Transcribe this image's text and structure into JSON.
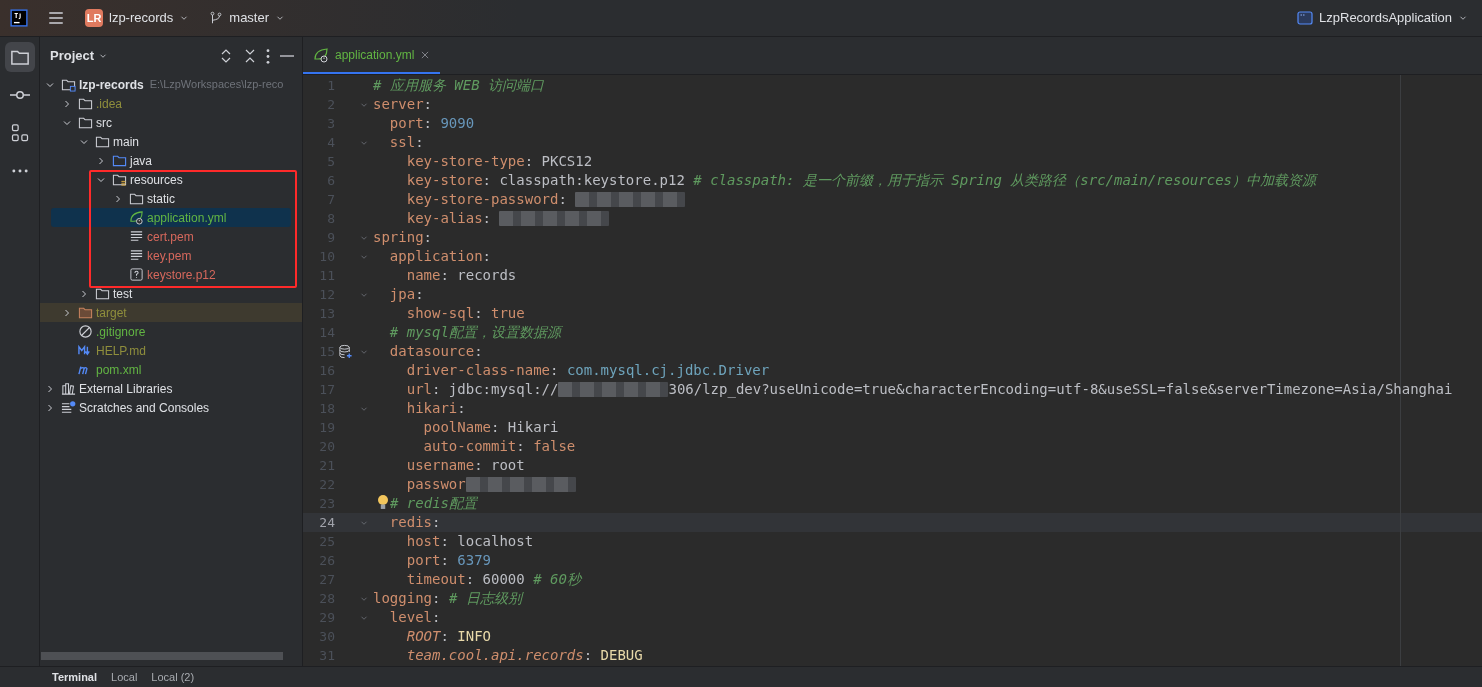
{
  "toolbar": {
    "project_badge": "LR",
    "project": "lzp-records",
    "branch": "master",
    "run_config": "LzpRecordsApplication"
  },
  "side_tools": [
    {
      "kind": "project",
      "selected": true
    },
    {
      "kind": "commit",
      "selected": false
    },
    {
      "kind": "structure",
      "selected": false
    },
    {
      "kind": "more",
      "selected": false
    }
  ],
  "project_panel": {
    "title": "Project",
    "tree": [
      {
        "label": "lzp-records",
        "hint": "E:\\LzpWorkspaces\\lzp-reco",
        "kind": "module",
        "color": "#dfe1e5",
        "bold": true,
        "expanded": true,
        "selected": false,
        "children": [
          {
            "label": ".idea",
            "kind": "folder",
            "color": "#8f8e3c",
            "expanded": false,
            "selected": false
          },
          {
            "label": "src",
            "kind": "folder",
            "color": "#dfe1e5",
            "expanded": true,
            "selected": false,
            "children": [
              {
                "label": "main",
                "kind": "folder",
                "color": "#dfe1e5",
                "expanded": true,
                "selected": false,
                "children": [
                  {
                    "label": "java",
                    "kind": "source_folder",
                    "color": "#dfe1e5",
                    "expanded": false,
                    "selected": false
                  },
                  {
                    "label": "resources",
                    "kind": "resource_folder",
                    "color": "#dfe1e5",
                    "expanded": true,
                    "selected": false,
                    "children": [
                      {
                        "label": "static",
                        "kind": "folder",
                        "color": "#dfe1e5",
                        "expanded": false,
                        "selected": false
                      },
                      {
                        "label": "application.yml",
                        "kind": "spring_yaml",
                        "color": "#62b543",
                        "selected": true
                      },
                      {
                        "label": "cert.pem",
                        "kind": "text",
                        "color": "#d7685c",
                        "selected": false
                      },
                      {
                        "label": "key.pem",
                        "kind": "text",
                        "color": "#d7685c",
                        "selected": false
                      },
                      {
                        "label": "keystore.p12",
                        "kind": "unknown",
                        "color": "#d7685c",
                        "selected": false
                      }
                    ]
                  }
                ]
              },
              {
                "label": "test",
                "kind": "folder",
                "color": "#dfe1e5",
                "expanded": false,
                "selected": false
              }
            ]
          },
          {
            "label": "target",
            "kind": "excluded_folder",
            "color": "#8f8e3c",
            "expanded": false,
            "selected": false
          },
          {
            "label": ".gitignore",
            "kind": "ignore",
            "color": "#62b543",
            "selected": false
          },
          {
            "label": "HELP.md",
            "kind": "markdown",
            "color": "#8f8e3c",
            "selected": false
          },
          {
            "label": "pom.xml",
            "kind": "maven",
            "color": "#62b543",
            "selected": false
          }
        ]
      },
      {
        "label": "External Libraries",
        "kind": "libraries",
        "color": "#dfe1e5",
        "expanded": false,
        "selected": false
      },
      {
        "label": "Scratches and Consoles",
        "kind": "scratches",
        "color": "#dfe1e5",
        "expanded": false,
        "selected": false
      }
    ]
  },
  "editor_tabs": [
    {
      "label": "application.yml",
      "selected": true
    }
  ],
  "code_lines": [
    {
      "number": "1",
      "foldable": false,
      "current": false,
      "tokens": [
        {
          "kind": "comment",
          "text": "# 应用服务 WEB 访问端口"
        }
      ]
    },
    {
      "number": "2",
      "foldable": true,
      "current": false,
      "tokens": [
        {
          "kind": "key",
          "text": "server"
        },
        {
          "kind": "plain",
          "text": ":"
        }
      ]
    },
    {
      "number": "3",
      "foldable": false,
      "current": false,
      "tokens": [
        {
          "kind": "key",
          "text": "  port"
        },
        {
          "kind": "plain",
          "text": ": "
        },
        {
          "kind": "number",
          "text": "9090"
        }
      ]
    },
    {
      "number": "4",
      "foldable": true,
      "current": false,
      "tokens": [
        {
          "kind": "key",
          "text": "  ssl"
        },
        {
          "kind": "plain",
          "text": ":"
        }
      ]
    },
    {
      "number": "5",
      "foldable": false,
      "current": false,
      "tokens": [
        {
          "kind": "key",
          "text": "    key-store-type"
        },
        {
          "kind": "plain",
          "text": ": PKCS12"
        }
      ]
    },
    {
      "number": "6",
      "foldable": false,
      "current": false,
      "tokens": [
        {
          "kind": "key",
          "text": "    key-store"
        },
        {
          "kind": "plain",
          "text": ": classpath:keystore.p12 "
        },
        {
          "kind": "comment",
          "text": "# classpath: 是一个前缀，用于指示 Spring 从类路径（src/main/resources）中加载资源"
        }
      ]
    },
    {
      "number": "7",
      "foldable": false,
      "current": false,
      "tokens": [
        {
          "kind": "key",
          "text": "    key-store-password"
        },
        {
          "kind": "plain",
          "text": ": "
        },
        {
          "kind": "redacted"
        }
      ]
    },
    {
      "number": "8",
      "foldable": false,
      "current": false,
      "tokens": [
        {
          "kind": "key",
          "text": "    key-alias"
        },
        {
          "kind": "plain",
          "text": ": "
        },
        {
          "kind": "redacted"
        }
      ]
    },
    {
      "number": "9",
      "foldable": true,
      "current": false,
      "tokens": [
        {
          "kind": "key",
          "text": "spring"
        },
        {
          "kind": "plain",
          "text": ":"
        }
      ]
    },
    {
      "number": "10",
      "foldable": true,
      "current": false,
      "tokens": [
        {
          "kind": "key",
          "text": "  application"
        },
        {
          "kind": "plain",
          "text": ":"
        }
      ]
    },
    {
      "number": "11",
      "foldable": false,
      "current": false,
      "tokens": [
        {
          "kind": "key",
          "text": "    name"
        },
        {
          "kind": "plain",
          "text": ": records"
        }
      ]
    },
    {
      "number": "12",
      "foldable": true,
      "current": false,
      "tokens": [
        {
          "kind": "key",
          "text": "  jpa"
        },
        {
          "kind": "plain",
          "text": ":"
        }
      ]
    },
    {
      "number": "13",
      "foldable": false,
      "current": false,
      "tokens": [
        {
          "kind": "key",
          "text": "    show-sql"
        },
        {
          "kind": "plain",
          "text": ": "
        },
        {
          "kind": "bool",
          "text": "true"
        }
      ]
    },
    {
      "number": "14",
      "foldable": false,
      "current": false,
      "tokens": [
        {
          "kind": "comment",
          "text": "  # mysql配置，设置数据源"
        }
      ]
    },
    {
      "number": "15",
      "foldable": true,
      "current": false,
      "database_marker": true,
      "tokens": [
        {
          "kind": "key",
          "text": "  datasource"
        },
        {
          "kind": "plain",
          "text": ":"
        }
      ]
    },
    {
      "number": "16",
      "foldable": false,
      "current": false,
      "tokens": [
        {
          "kind": "key",
          "text": "    driver-class-name"
        },
        {
          "kind": "plain",
          "text": ": "
        },
        {
          "kind": "class",
          "text": "com.mysql.cj.jdbc.Driver"
        }
      ]
    },
    {
      "number": "17",
      "foldable": false,
      "current": false,
      "tokens": [
        {
          "kind": "key",
          "text": "    url"
        },
        {
          "kind": "plain",
          "text": ": jdbc:mysql://"
        },
        {
          "kind": "redacted"
        },
        {
          "kind": "plain",
          "text": "306/lzp_dev?useUnicode=true&characterEncoding=utf-8&useSSL=false&serverTimezone=Asia/Shanghai"
        }
      ]
    },
    {
      "number": "18",
      "foldable": true,
      "current": false,
      "tokens": [
        {
          "kind": "key",
          "text": "    hikari"
        },
        {
          "kind": "plain",
          "text": ":"
        }
      ]
    },
    {
      "number": "19",
      "foldable": false,
      "current": false,
      "tokens": [
        {
          "kind": "key",
          "text": "      poolName"
        },
        {
          "kind": "plain",
          "text": ": Hikari"
        }
      ]
    },
    {
      "number": "20",
      "foldable": false,
      "current": false,
      "tokens": [
        {
          "kind": "key",
          "text": "      auto-commit"
        },
        {
          "kind": "plain",
          "text": ": "
        },
        {
          "kind": "bool",
          "text": "false"
        }
      ]
    },
    {
      "number": "21",
      "foldable": false,
      "current": false,
      "tokens": [
        {
          "kind": "key",
          "text": "    username"
        },
        {
          "kind": "plain",
          "text": ": root"
        }
      ]
    },
    {
      "number": "22",
      "foldable": false,
      "current": false,
      "tokens": [
        {
          "kind": "key",
          "text": "    passwor"
        },
        {
          "kind": "redacted"
        }
      ]
    },
    {
      "number": "23",
      "foldable": false,
      "current": false,
      "bulb": true,
      "tokens": [
        {
          "kind": "comment",
          "text": "# redis配置"
        }
      ]
    },
    {
      "number": "24",
      "foldable": true,
      "current": true,
      "tokens": [
        {
          "kind": "key",
          "text": "  redis"
        },
        {
          "kind": "plain",
          "text": ":"
        }
      ]
    },
    {
      "number": "25",
      "foldable": false,
      "current": false,
      "tokens": [
        {
          "kind": "key",
          "text": "    host"
        },
        {
          "kind": "plain",
          "text": ": localhost"
        }
      ]
    },
    {
      "number": "26",
      "foldable": false,
      "current": false,
      "tokens": [
        {
          "kind": "key",
          "text": "    port"
        },
        {
          "kind": "plain",
          "text": ": "
        },
        {
          "kind": "number",
          "text": "6379"
        }
      ]
    },
    {
      "number": "27",
      "foldable": false,
      "current": false,
      "tokens": [
        {
          "kind": "key",
          "text": "    timeout"
        },
        {
          "kind": "plain",
          "text": ": 60000 "
        },
        {
          "kind": "comment",
          "text": "# 60秒"
        }
      ]
    },
    {
      "number": "28",
      "foldable": true,
      "current": false,
      "tokens": [
        {
          "kind": "key",
          "text": "logging"
        },
        {
          "kind": "plain",
          "text": ": "
        },
        {
          "kind": "comment",
          "text": "# 日志级别"
        }
      ]
    },
    {
      "number": "29",
      "foldable": true,
      "current": false,
      "tokens": [
        {
          "kind": "key",
          "text": "  level"
        },
        {
          "kind": "plain",
          "text": ":"
        }
      ]
    },
    {
      "number": "30",
      "foldable": false,
      "current": false,
      "tokens": [
        {
          "kind": "key_italic",
          "text": "    ROOT"
        },
        {
          "kind": "plain",
          "text": ": "
        },
        {
          "kind": "enum",
          "text": "INFO"
        }
      ]
    },
    {
      "number": "31",
      "foldable": false,
      "current": false,
      "tokens": [
        {
          "kind": "key_italic",
          "text": "    team.cool.api.records"
        },
        {
          "kind": "plain",
          "text": ": "
        },
        {
          "kind": "enum",
          "text": "DEBUG"
        }
      ]
    }
  ],
  "bottom_tabs": [
    {
      "label": "Terminal",
      "selected": true
    },
    {
      "label": "Local",
      "selected": false
    },
    {
      "label": "Local (2)",
      "selected": false
    }
  ]
}
